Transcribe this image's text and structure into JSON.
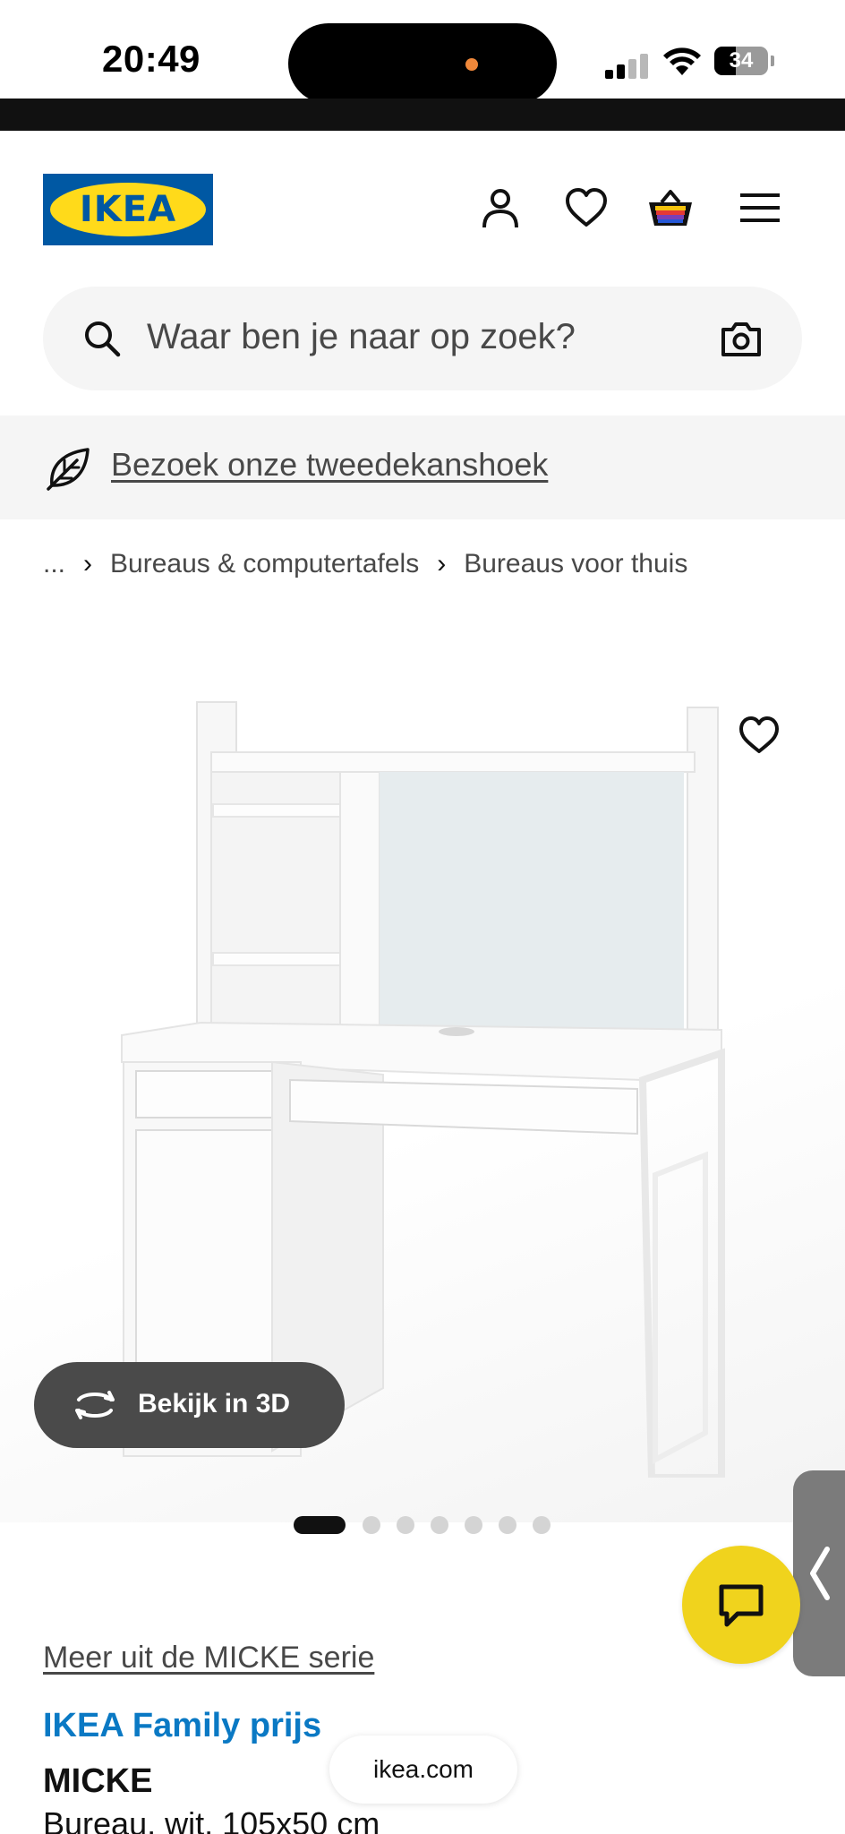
{
  "status_bar": {
    "time": "20:49",
    "battery": "34"
  },
  "header": {
    "logo_text": "IKEA",
    "icons": [
      "user-icon",
      "heart-icon",
      "basket-icon",
      "menu-icon"
    ]
  },
  "search": {
    "placeholder": "Waar ben je naar op zoek?"
  },
  "banner": {
    "link": "Bezoek onze tweedekanshoek"
  },
  "breadcrumb": {
    "items": [
      "...",
      "Bureaus & computertafels",
      "Bureaus voor thuis"
    ]
  },
  "product_image": {
    "view_3d_label": "Bekijk in 3D",
    "carousel_active_index": 0,
    "carousel_count": 7
  },
  "product": {
    "series_link": "Meer uit de MICKE serie",
    "family_price_label": "IKEA Family prijs",
    "name": "MICKE",
    "description": "Bureau, wit, 105x50 cm"
  },
  "browser": {
    "url": "ikea.com"
  },
  "colors": {
    "ikea_blue": "#0058a3",
    "ikea_yellow": "#ffda1a",
    "family_blue": "#0a79c4",
    "chat_yellow": "#f0d31d"
  }
}
